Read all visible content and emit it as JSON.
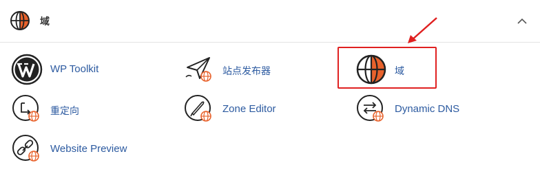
{
  "section": {
    "title": "域",
    "collapse_icon": "chevron-up-icon"
  },
  "items": [
    {
      "id": "wp",
      "label": "WP Toolkit",
      "icon": "wordpress-icon"
    },
    {
      "id": "site",
      "label": "站点发布器",
      "icon": "site-publisher-icon"
    },
    {
      "id": "dom",
      "label": "域",
      "icon": "globe-icon"
    },
    {
      "id": "red",
      "label": "重定向",
      "icon": "redirect-icon"
    },
    {
      "id": "zone",
      "label": "Zone Editor",
      "icon": "zone-editor-icon"
    },
    {
      "id": "dyn",
      "label": "Dynamic DNS",
      "icon": "dynamic-dns-icon"
    },
    {
      "id": "prev",
      "label": "Website Preview",
      "icon": "link-preview-icon"
    }
  ],
  "colors": {
    "accent_orange": "#e8622c",
    "label_blue": "#2c5aa0",
    "annotation_red": "#e02020"
  }
}
